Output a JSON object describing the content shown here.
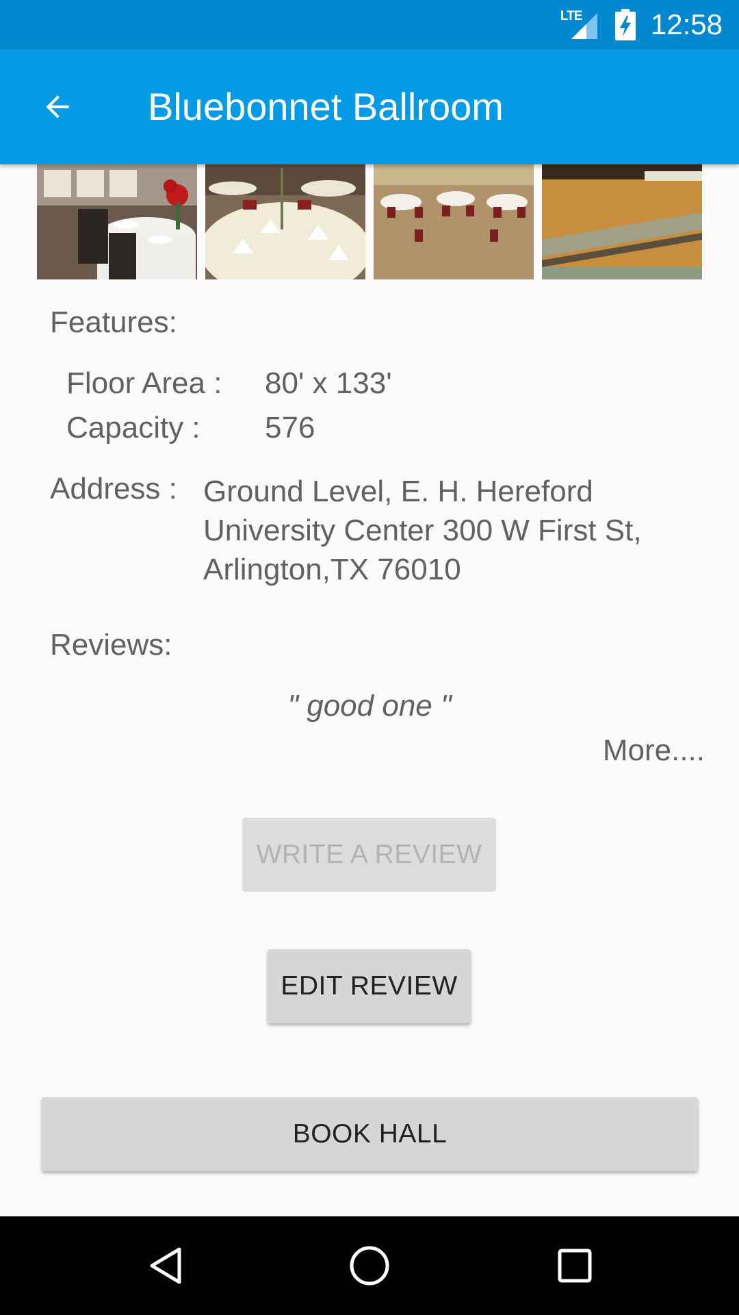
{
  "status_bar": {
    "network": "LTE",
    "time": "12:58",
    "icons": [
      "lte-signal-icon",
      "battery-charging-icon"
    ]
  },
  "app_bar": {
    "title": "Bluebonnet Ballroom",
    "back_icon": "arrow-back-icon"
  },
  "gallery": {
    "images": [
      "banquet-table-photo",
      "table-setting-photo",
      "ballroom-tables-photo",
      "ballroom-floor-photo"
    ]
  },
  "features": {
    "heading": "Features:",
    "floor_area_label": "Floor Area :",
    "floor_area_value": "80' x 133'",
    "capacity_label": "Capacity :",
    "capacity_value": "576"
  },
  "address": {
    "label": "Address :",
    "value": "Ground Level, E. H. Hereford University Center 300 W First St, Arlington,TX 76010"
  },
  "reviews": {
    "heading": "Reviews:",
    "quote": "\" good one \"",
    "more_link": "More...."
  },
  "buttons": {
    "write_review": "WRITE A REVIEW",
    "write_review_state": "disabled",
    "edit_review": "EDIT REVIEW",
    "book_hall": "BOOK HALL"
  },
  "nav_bar": {
    "icons": [
      "nav-back-icon",
      "nav-home-icon",
      "nav-recents-icon"
    ]
  },
  "colors": {
    "status_bar": "#0288d1",
    "app_bar": "#039be5",
    "text": "#616161",
    "button": "#d6d6d6"
  }
}
